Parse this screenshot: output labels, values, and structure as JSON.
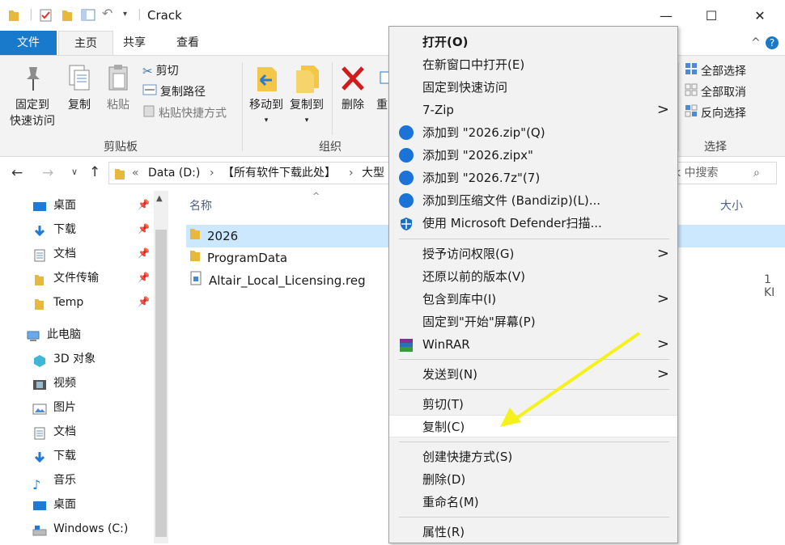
{
  "window": {
    "title": "Crack",
    "minimize": "—",
    "maximize": "☐",
    "close": "✕"
  },
  "tabs": {
    "file": "文件",
    "home": "主页",
    "share": "共享",
    "view": "查看",
    "collapse": "^",
    "help": "?"
  },
  "ribbon": {
    "pin": "固定到\n快速访问",
    "pin_line1": "固定到",
    "pin_line2": "快速访问",
    "copy": "复制",
    "paste": "粘贴",
    "cut": "剪切",
    "copy_path": "复制路径",
    "paste_shortcut": "粘贴快捷方式",
    "clipboard_group": "剪贴板",
    "move_to": "移动到",
    "copy_to": "复制到",
    "delete": "删除",
    "rename_partial": "重",
    "organize_group": "组织",
    "select_all": "全部选择",
    "select_none": "全部取消",
    "invert_selection": "反向选择",
    "select_group": "选择"
  },
  "address": {
    "path_prefix": "«",
    "seg1": "Data (D:)",
    "seg2": "【所有软件下载此处】",
    "seg3": "大型",
    "search_placeholder": "k 中搜索"
  },
  "nav": {
    "items": [
      {
        "label": "桌面",
        "pinned": true
      },
      {
        "label": "下载",
        "pinned": true
      },
      {
        "label": "文档",
        "pinned": true
      },
      {
        "label": "文件传输",
        "pinned": true
      },
      {
        "label": "Temp",
        "pinned": true
      },
      {
        "label": "此电脑"
      },
      {
        "label": "3D 对象"
      },
      {
        "label": "视频"
      },
      {
        "label": "图片"
      },
      {
        "label": "文档"
      },
      {
        "label": "下载"
      },
      {
        "label": "音乐"
      },
      {
        "label": "桌面"
      },
      {
        "label": "Windows (C:)"
      }
    ]
  },
  "files": {
    "col_name": "名称",
    "col_size": "大小",
    "rows": [
      {
        "name": "2026",
        "size": ""
      },
      {
        "name": "ProgramData",
        "size": ""
      },
      {
        "name": "Altair_Local_Licensing.reg",
        "size": "1 KI"
      }
    ]
  },
  "context_menu": {
    "items": [
      {
        "label": "打开(O)"
      },
      {
        "label": "在新窗口中打开(E)"
      },
      {
        "label": "固定到快速访问"
      },
      {
        "label": "7-Zip",
        "submenu": ">"
      },
      {
        "label": "添加到 \"2026.zip\"(Q)"
      },
      {
        "label": "添加到 \"2026.zipx\""
      },
      {
        "label": "添加到 \"2026.7z\"(7)"
      },
      {
        "label": "添加到压缩文件 (Bandizip)(L)..."
      },
      {
        "label": "使用 Microsoft Defender扫描..."
      },
      {
        "label": "授予访问权限(G)",
        "submenu": ">"
      },
      {
        "label": "还原以前的版本(V)"
      },
      {
        "label": "包含到库中(I)",
        "submenu": ">"
      },
      {
        "label": "固定到\"开始\"屏幕(P)"
      },
      {
        "label": "WinRAR",
        "submenu": ">"
      },
      {
        "label": "发送到(N)",
        "submenu": ">"
      },
      {
        "label": "剪切(T)"
      },
      {
        "label": "复制(C)"
      },
      {
        "label": "创建快捷方式(S)"
      },
      {
        "label": "删除(D)"
      },
      {
        "label": "重命名(M)"
      },
      {
        "label": "属性(R)"
      }
    ]
  },
  "colors": {
    "accent": "#1979ca",
    "selection": "#cce8ff",
    "annotation_arrow": "#f5f11a"
  }
}
